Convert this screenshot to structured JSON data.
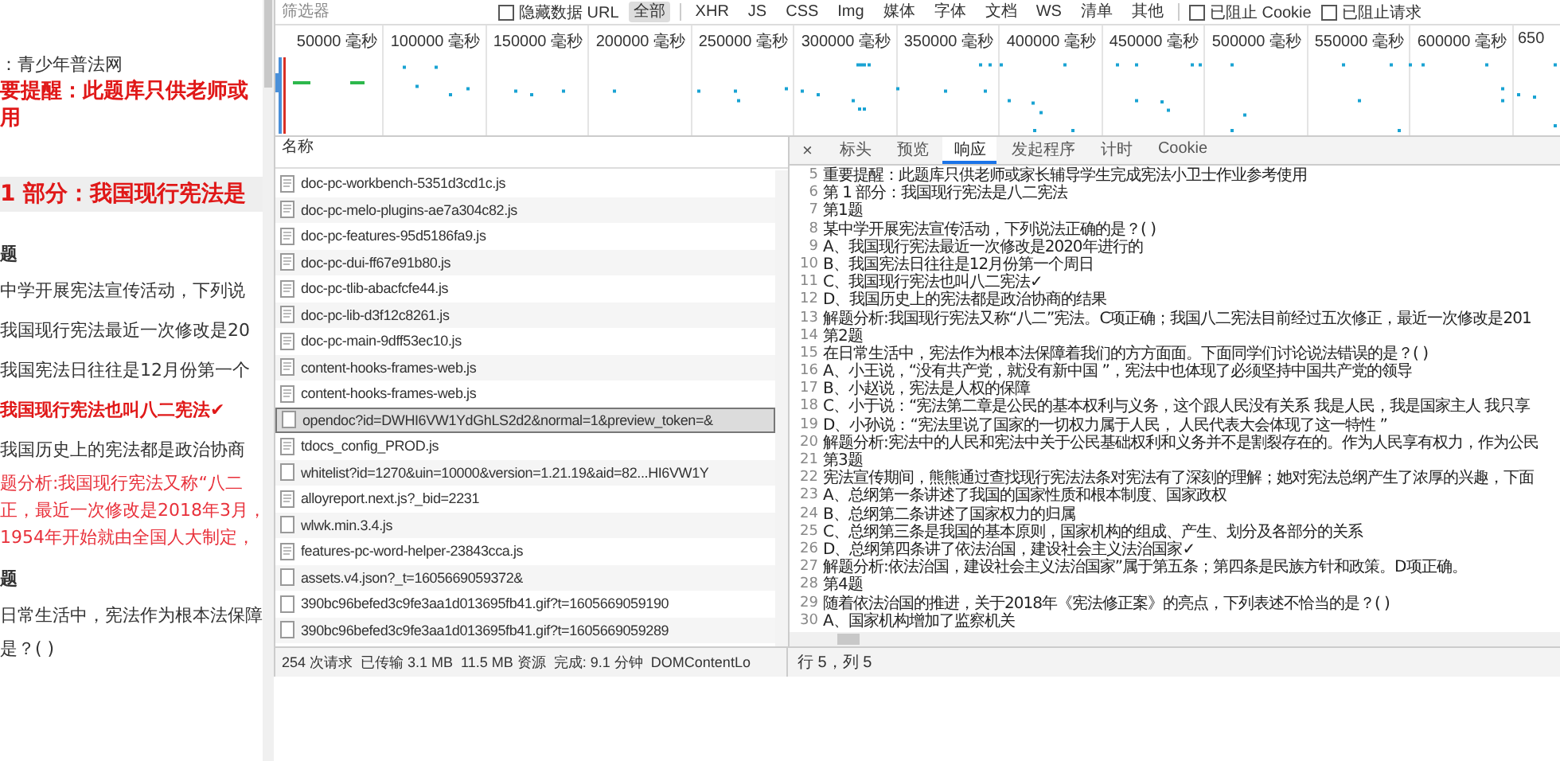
{
  "page": {
    "lines": [
      {
        "kind": "source",
        "text": "：青少年普法网"
      },
      {
        "kind": "notice",
        "text": "要提醒：此题库只供老师或"
      },
      {
        "kind": "notice",
        "text": "用"
      },
      {
        "kind": "heading",
        "text": "1 部分：我国现行宪法是"
      },
      {
        "kind": "number",
        "text": "题"
      },
      {
        "kind": "plain",
        "text": "中学开展宪法宣传活动，下列说"
      },
      {
        "kind": "plain",
        "text": "我国现行宪法最近一次修改是20"
      },
      {
        "kind": "plain",
        "text": "我国宪法日往往是12月份第一个"
      },
      {
        "kind": "answer",
        "text": "我国现行宪法也叫八二宪法✔"
      },
      {
        "kind": "plain",
        "text": "我国历史上的宪法都是政治协商"
      },
      {
        "kind": "analysis",
        "text": "题分析:我国现行宪法又称“八二"
      },
      {
        "kind": "analysis",
        "text": "正，最近一次修改是2018年3月，"
      },
      {
        "kind": "analysis",
        "text": "1954年开始就由全国人大制定，"
      },
      {
        "kind": "number",
        "text": "题"
      },
      {
        "kind": "plain",
        "text": "日常生活中，宪法作为根本法保障"
      },
      {
        "kind": "continued",
        "text": "是？( )"
      }
    ]
  },
  "filter_bar": {
    "filter": {
      "placeholder": "筛选器"
    },
    "hide_data_urls": {
      "label": "隐藏数据 URL",
      "checked": false
    },
    "types": [
      {
        "label": "全部",
        "selected": true
      },
      {
        "label": "XHR",
        "selected": false
      },
      {
        "label": "JS",
        "selected": false
      },
      {
        "label": "CSS",
        "selected": false
      },
      {
        "label": "Img",
        "selected": false
      },
      {
        "label": "媒体",
        "selected": false
      },
      {
        "label": "字体",
        "selected": false
      },
      {
        "label": "文档",
        "selected": false
      },
      {
        "label": "WS",
        "selected": false
      },
      {
        "label": "清单",
        "selected": false
      },
      {
        "label": "其他",
        "selected": false
      }
    ],
    "blocked_cookies": {
      "label": "已阻止 Cookie",
      "checked": false
    },
    "blocked_requests": {
      "label": "已阻止请求",
      "checked": false
    }
  },
  "overview": {
    "ticks": [
      "50000 毫秒",
      "100000 毫秒",
      "150000 毫秒",
      "200000 毫秒",
      "250000 毫秒",
      "300000 毫秒",
      "350000 毫秒",
      "400000 毫秒",
      "450000 毫秒",
      "500000 毫秒",
      "550000 毫秒",
      "600000 毫秒",
      "650"
    ]
  },
  "requests": {
    "column": "名称",
    "rows": [
      {
        "name": "doc-pc-workbench-5351d3cd1c.js",
        "kind": "script",
        "selected": false
      },
      {
        "name": "doc-pc-melo-plugins-ae7a304c82.js",
        "kind": "script",
        "selected": false
      },
      {
        "name": "doc-pc-features-95d5186fa9.js",
        "kind": "script",
        "selected": false
      },
      {
        "name": "doc-pc-dui-ff67e91b80.js",
        "kind": "script",
        "selected": false
      },
      {
        "name": "doc-pc-tlib-abacfcfe44.js",
        "kind": "script",
        "selected": false
      },
      {
        "name": "doc-pc-lib-d3f12c8261.js",
        "kind": "script",
        "selected": false
      },
      {
        "name": "doc-pc-main-9dff53ec10.js",
        "kind": "script",
        "selected": false
      },
      {
        "name": "content-hooks-frames-web.js",
        "kind": "script",
        "selected": false
      },
      {
        "name": "content-hooks-frames-web.js",
        "kind": "script",
        "selected": false
      },
      {
        "name": "opendoc?id=DWHI6VW1YdGhLS2d2&normal=1&preview_token=&",
        "kind": "other",
        "selected": true
      },
      {
        "name": "tdocs_config_PROD.js",
        "kind": "script",
        "selected": false
      },
      {
        "name": "whitelist?id=1270&uin=10000&version=1.21.19&aid=82...HI6VW1Y",
        "kind": "other",
        "selected": false
      },
      {
        "name": "alloyreport.next.js?_bid=2231",
        "kind": "script",
        "selected": false
      },
      {
        "name": "wlwk.min.3.4.js",
        "kind": "other",
        "selected": false
      },
      {
        "name": "features-pc-word-helper-23843cca.js",
        "kind": "script",
        "selected": false
      },
      {
        "name": "assets.v4.json?_t=1605669059372&",
        "kind": "other",
        "selected": false
      },
      {
        "name": "390bc96befed3c9fe3aa1d013695fb41.gif?t=1605669059190",
        "kind": "other",
        "selected": false
      },
      {
        "name": "390bc96befed3c9fe3aa1d013695fb41.gif?t=1605669059289",
        "kind": "other",
        "selected": false
      }
    ]
  },
  "response": {
    "close": "×",
    "tabs": [
      {
        "label": "标头",
        "selected": false
      },
      {
        "label": "预览",
        "selected": false
      },
      {
        "label": "响应",
        "selected": true
      },
      {
        "label": "发起程序",
        "selected": false
      },
      {
        "label": "计时",
        "selected": false
      },
      {
        "label": "Cookie",
        "selected": false
      }
    ],
    "lines": [
      {
        "number": "5",
        "text": "重要提醒：此题库只供老师或家长辅导学生完成宪法小卫士作业参考使用"
      },
      {
        "number": "6",
        "text": "第 1 部分：我国现行宪法是八二宪法"
      },
      {
        "number": "7",
        "text": "第1题"
      },
      {
        "number": "8",
        "text": "某中学开展宪法宣传活动，下列说法正确的是？( )"
      },
      {
        "number": "9",
        "text": "A、我国现行宪法最近一次修改是2020年进行的"
      },
      {
        "number": "10",
        "text": "B、我国宪法日往往是12月份第一个周日"
      },
      {
        "number": "11",
        "text": "C、我国现行宪法也叫八二宪法✓"
      },
      {
        "number": "12",
        "text": "D、我国历史上的宪法都是政治协商的结果"
      },
      {
        "number": "13",
        "text": "解题分析:我国现行宪法又称“八二”宪法。C项正确；我国八二宪法目前经过五次修正，最近一次修改是201"
      },
      {
        "number": "14",
        "text": "第2题"
      },
      {
        "number": "15",
        "text": "在日常生活中，宪法作为根本法保障着我们的方方面面。下面同学们讨论说法错误的是？( )"
      },
      {
        "number": "16",
        "text": "A、小王说，“没有共产党，就没有新中国 ”，宪法中也体现了必须坚持中国共产党的领导"
      },
      {
        "number": "17",
        "text": "B、小赵说，宪法是人权的保障"
      },
      {
        "number": "18",
        "text": "C、小于说：“宪法第二章是公民的基本权利与义务，这个跟人民没有关系 我是人民，我是国家主人 我只享"
      },
      {
        "number": "19",
        "text": "D、小孙说：“宪法里说了国家的一切权力属于人民， 人民代表大会体现了这一特性 ”"
      },
      {
        "number": "20",
        "text": "解题分析:宪法中的人民和宪法中关于公民基础权利和义务并不是割裂存在的。作为人民享有权力，作为公民"
      },
      {
        "number": "21",
        "text": "第3题"
      },
      {
        "number": "22",
        "text": "宪法宣传期间，熊熊通过查找现行宪法法条对宪法有了深刻的理解；她对宪法总纲产生了浓厚的兴趣，下面"
      },
      {
        "number": "23",
        "text": "A、总纲第一条讲述了我国的国家性质和根本制度、国家政权"
      },
      {
        "number": "24",
        "text": "B、总纲第二条讲述了国家权力的归属"
      },
      {
        "number": "25",
        "text": "C、总纲第三条是我国的基本原则，国家机构的组成、产生、划分及各部分的关系"
      },
      {
        "number": "26",
        "text": "D、总纲第四条讲了依法治国，建设社会主义法治国家✓"
      },
      {
        "number": "27",
        "text": "解题分析:依法治国，建设社会主义法治国家”属于第五条；第四条是民族方针和政策。D项正确。"
      },
      {
        "number": "28",
        "text": "第4题"
      },
      {
        "number": "29",
        "text": "随着依法治国的推进，关于2018年《宪法修正案》的亮点，下列表述不恰当的是？( )"
      },
      {
        "number": "30",
        "text": "A、国家机构增加了监察机关"
      }
    ],
    "cursor": "行 5，列 5"
  },
  "status": [
    "254 次请求",
    "已传输 3.1 MB",
    "11.5 MB 资源",
    "完成: 9.1 分钟",
    "DOMContentLo"
  ]
}
